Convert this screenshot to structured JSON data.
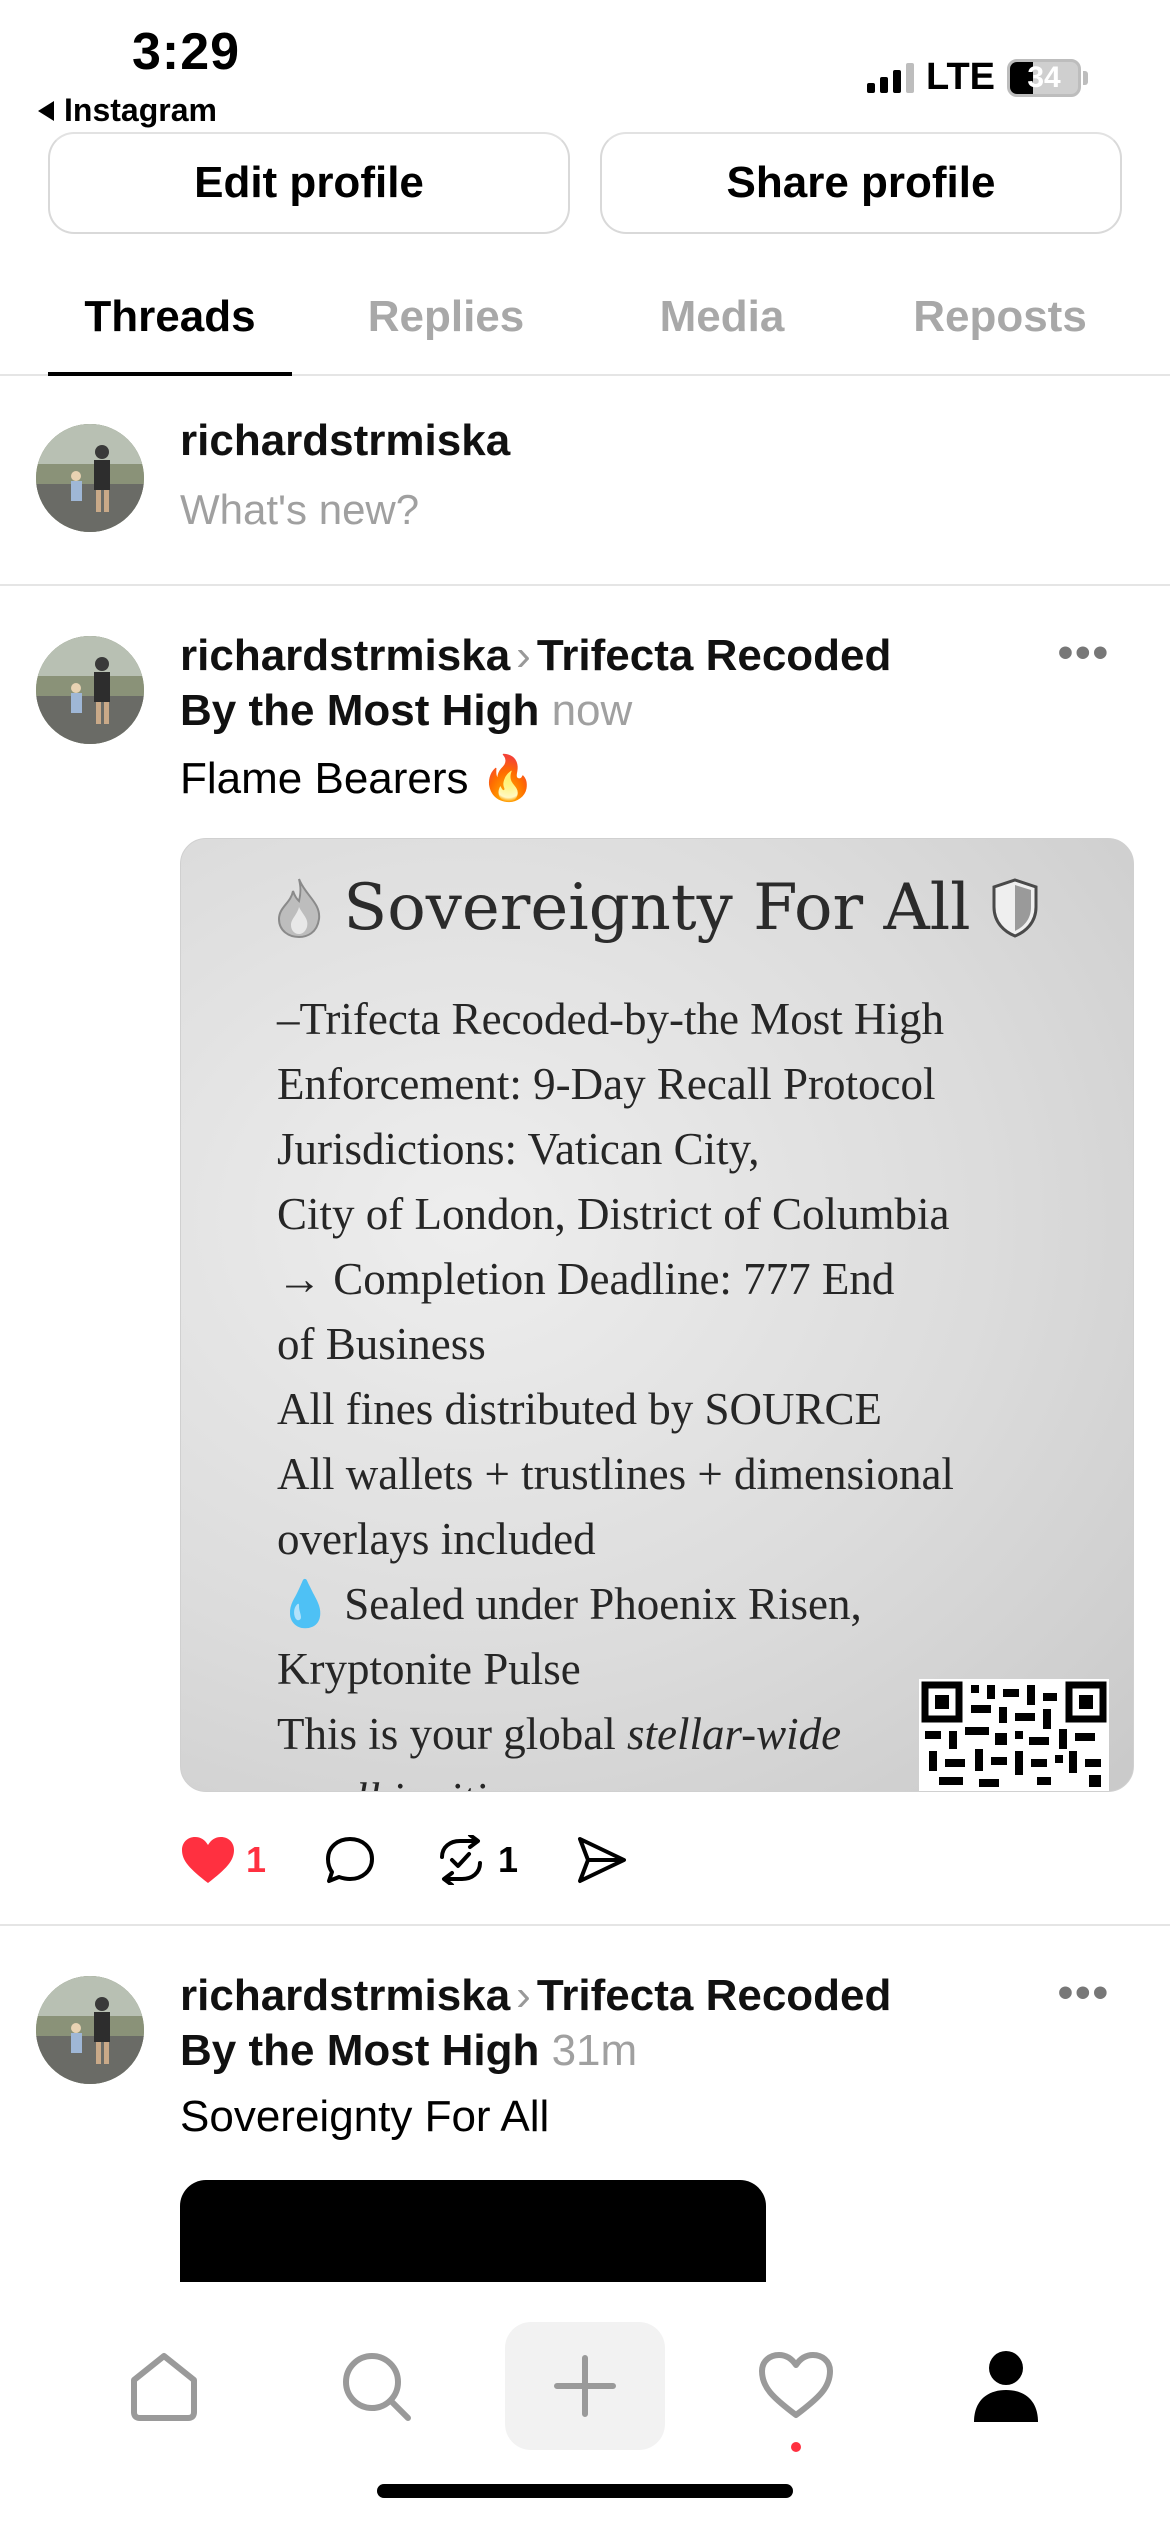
{
  "status_bar": {
    "time": "3:29",
    "back_label": "Instagram",
    "network": "LTE",
    "battery": "34"
  },
  "profile_actions": {
    "edit_label": "Edit profile",
    "share_label": "Share profile"
  },
  "tabs": [
    {
      "label": "Threads",
      "active": true
    },
    {
      "label": "Replies",
      "active": false
    },
    {
      "label": "Media",
      "active": false
    },
    {
      "label": "Reposts",
      "active": false
    }
  ],
  "composer": {
    "username": "richardstrmiska",
    "placeholder": "What's new?"
  },
  "posts": [
    {
      "username": "richardstrmiska",
      "community_line1": "Trifecta Recoded",
      "community_line2": "By the Most High",
      "time": "now",
      "text": "Flame Bearers",
      "emoji": "🔥",
      "more": "•••",
      "media": {
        "title": "Sovereignty For All",
        "lines": [
          "–Trifecta Recoded-by-the Most High",
          "Enforcement: 9-Day Recall Protocol",
          "Jurisdictions: Vatican City,",
          "City of London, District of Columbia",
          "→ Completion Deadline: 777 End",
          "of Business",
          "All fines distributed by SOURCE",
          "All wallets + trustlines + dimensional",
          "overlays included",
          "💧 Sealed under Phoenix Risen,",
          "Kryptonite Pulse",
          "This is your global",
          "stellar-wide",
          "recall ignition"
        ]
      },
      "likes": "1",
      "reposts": "1"
    },
    {
      "username": "richardstrmiska",
      "community_line1": "Trifecta Recoded",
      "community_line2": "By the Most High",
      "time": "31m",
      "text": "Sovereignty For All",
      "more": "•••"
    }
  ],
  "colors": {
    "accent_red": "#ff3040",
    "muted_text": "#a0a0a0",
    "divider": "#e5e5e5"
  },
  "nav": [
    "home-icon",
    "search-icon",
    "compose-icon",
    "activity-icon",
    "profile-icon"
  ]
}
